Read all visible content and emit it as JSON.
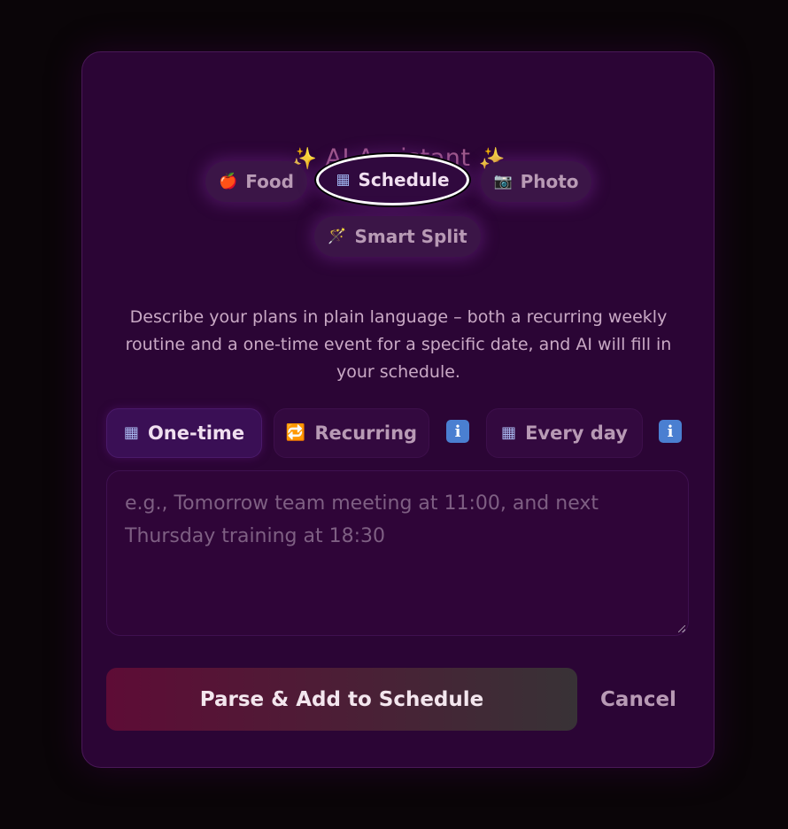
{
  "modal": {
    "title_spark_left": "✨",
    "title_text": "AI Assistant",
    "title_spark_right": "✨"
  },
  "modes": {
    "food": {
      "icon": "🍎",
      "label": "Food"
    },
    "schedule": {
      "icon": "▦",
      "label": "Schedule"
    },
    "photo": {
      "icon": "📷",
      "label": "Photo"
    },
    "smart_split": {
      "icon": "🪄",
      "label": "Smart Split"
    },
    "active": "Schedule"
  },
  "description": "Describe your plans in plain language – both a recurring weekly routine and a one-time event for a specific date, and AI will fill in your schedule.",
  "schedule_tabs": {
    "one_time": {
      "icon": "▦",
      "label": "One-time"
    },
    "recurring": {
      "icon": "🔁",
      "label": "Recurring"
    },
    "every_day": {
      "icon": "▦",
      "label": "Every day"
    },
    "info_icon": "i",
    "active": "One-time"
  },
  "input": {
    "value": "",
    "placeholder": "e.g., Tomorrow team meeting at 11:00, and next Thursday training at 18:30"
  },
  "actions": {
    "primary_label": "Parse & Add to Schedule",
    "cancel_label": "Cancel"
  },
  "colors": {
    "modal_bg": "#2b0535",
    "title": "#a05a8c",
    "accent_info": "#4a7fd1",
    "button_gradient_start": "#5e0c36",
    "button_gradient_end": "#383236"
  }
}
